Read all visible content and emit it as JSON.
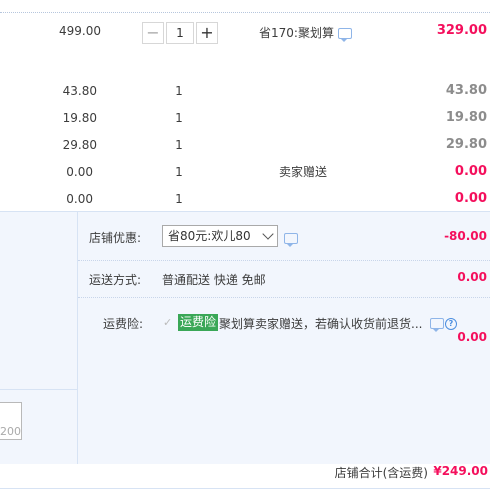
{
  "items": [
    {
      "unit_price": "499.00",
      "qty": "1",
      "promo": "省170:聚划算",
      "total": "329.00"
    },
    {
      "unit_price": "43.80",
      "qty": "1",
      "promo": "",
      "total": "43.80"
    },
    {
      "unit_price": "19.80",
      "qty": "1",
      "promo": "",
      "total": "19.80"
    },
    {
      "unit_price": "29.80",
      "qty": "1",
      "promo": "",
      "total": "29.80"
    },
    {
      "unit_price": "0.00",
      "qty": "1",
      "promo": "卖家赠送",
      "total": "0.00"
    },
    {
      "unit_price": "0.00",
      "qty": "1",
      "promo": "",
      "total": "0.00"
    }
  ],
  "stepper": {
    "minus": "−",
    "plus": "+",
    "value": "1"
  },
  "shop_discount": {
    "label": "店铺优惠:",
    "selected": "省80元:欢儿80",
    "amount": "-80.00"
  },
  "shipping": {
    "label": "运送方式:",
    "value": "普通配送 快递 免邮",
    "amount": "0.00"
  },
  "insurance": {
    "label": "运费险:",
    "tag": "运费险",
    "text": "聚划算卖家赠送，若确认收货前退货...",
    "help": "?",
    "amount": "0.00"
  },
  "left_box": {
    "text": "200"
  },
  "footer": {
    "label": "店铺合计(含运费)",
    "amount": "¥249.00"
  },
  "colors": {
    "accent_red": "#f40f5c",
    "panel_bg": "#f2f6fd",
    "tag_green": "#3aa757"
  }
}
